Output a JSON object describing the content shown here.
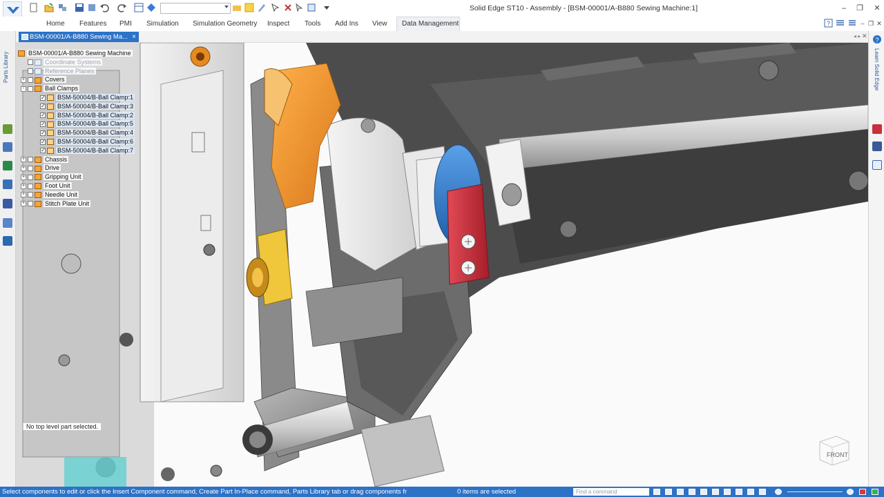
{
  "window": {
    "title": "Solid Edge ST10 - Assembly - [BSM-00001/A-B880 Sewing Machine:1]"
  },
  "quick_access": {
    "search_value": ""
  },
  "ribbon": {
    "tabs": [
      "Home",
      "Features",
      "PMI",
      "Simulation",
      "Simulation Geometry",
      "Inspect",
      "Tools",
      "Add Ins",
      "View",
      "Data Management"
    ],
    "active_tab": "Data Management"
  },
  "document": {
    "tab_label": "BSM-00001/A-B880 Sewing Ma...",
    "close_glyph": "×"
  },
  "side_tabs": {
    "left_label": "Parts Library",
    "right_label": "Learn Solid Edge"
  },
  "tree": {
    "root": "BSM-00001/A-B880 Sewing Machine",
    "items": [
      {
        "label": "Coordinate Systems",
        "indent": 1,
        "dim": true,
        "icon": "ref"
      },
      {
        "label": "Reference Planes",
        "indent": 1,
        "dim": true,
        "icon": "ref"
      },
      {
        "label": "Covers",
        "indent": 1,
        "icon": "asm",
        "exp": "+"
      },
      {
        "label": "Ball Clamps",
        "indent": 1,
        "icon": "asm",
        "exp": "-"
      },
      {
        "label": "BSM-50004/B-Ball Clamp:1",
        "indent": 2,
        "icon": "part",
        "chk": true,
        "sel": true
      },
      {
        "label": "BSM-50004/B-Ball Clamp:3",
        "indent": 2,
        "icon": "part",
        "chk": true,
        "sel": true
      },
      {
        "label": "BSM-50004/B-Ball Clamp:2",
        "indent": 2,
        "icon": "part",
        "chk": true,
        "sel": true
      },
      {
        "label": "BSM-50004/B-Ball Clamp:5",
        "indent": 2,
        "icon": "part",
        "chk": true,
        "sel": true
      },
      {
        "label": "BSM-50004/B-Ball Clamp:4",
        "indent": 2,
        "icon": "part",
        "chk": true,
        "sel": true
      },
      {
        "label": "BSM-50004/B-Ball Clamp:6",
        "indent": 2,
        "icon": "part",
        "chk": true,
        "sel": true
      },
      {
        "label": "BSM-50004/B-Ball Clamp:7",
        "indent": 2,
        "icon": "part",
        "chk": true,
        "sel": true
      },
      {
        "label": "Chassis",
        "indent": 1,
        "icon": "asm",
        "exp": "+"
      },
      {
        "label": "Drive",
        "indent": 1,
        "icon": "asm",
        "exp": "+"
      },
      {
        "label": "Gripping Unit",
        "indent": 1,
        "icon": "asm",
        "exp": "+"
      },
      {
        "label": "Foot Unit",
        "indent": 1,
        "icon": "asm",
        "exp": "+"
      },
      {
        "label": "Needle Unit",
        "indent": 1,
        "icon": "asm",
        "exp": "+"
      },
      {
        "label": "Stitch Plate Unit",
        "indent": 1,
        "icon": "asm",
        "exp": "+"
      }
    ]
  },
  "viewport": {
    "no_selection_text": "No top level part selected.",
    "view_cube_label": "FRONT"
  },
  "status": {
    "message": "Select components to edit or click the Insert Component command, Create Part In-Place command, Parts Library tab or drag components fr",
    "selection_count": "0 items are selected",
    "find_placeholder": "Find a command"
  },
  "colors": {
    "accent": "#2c72c7",
    "orange_part": "#f29b2b",
    "blue_part": "#2f78c8",
    "red_part": "#c8303c"
  }
}
